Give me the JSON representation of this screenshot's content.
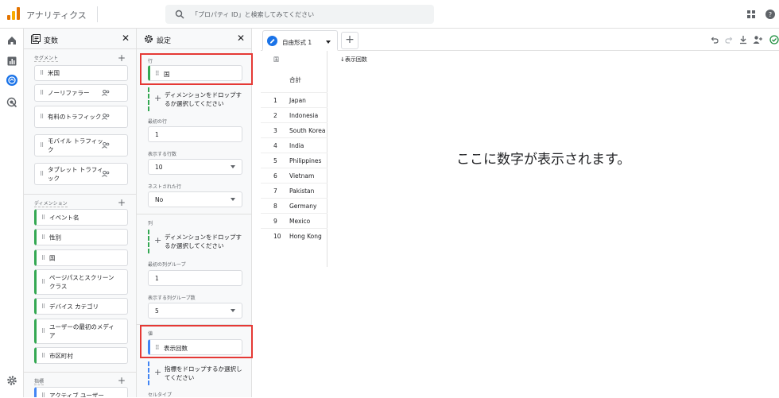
{
  "app": {
    "title": "アナリティクス"
  },
  "search": {
    "placeholder": "「プロパティ ID」と検索してみてください"
  },
  "variables_panel": {
    "title": "変数",
    "segments": {
      "label": "セグメント",
      "items": [
        "米国",
        "ノーリファラー",
        "有料のトラフィック",
        "モバイル トラフィック",
        "タブレット トラフィック"
      ]
    },
    "dimensions": {
      "label": "ディメンション",
      "items": [
        "イベント名",
        "性別",
        "国",
        "ページパスとスクリーン クラス",
        "デバイス カテゴリ",
        "ユーザーの最初のメディア",
        "市区町村"
      ]
    },
    "metrics": {
      "label": "指標",
      "items": [
        "アクティブ ユーザー"
      ]
    }
  },
  "settings_panel": {
    "title": "設定",
    "rows": {
      "label": "行",
      "chip": "国",
      "drop": "ディメンションをドロップするか選択してください"
    },
    "first_row": {
      "label": "最初の行",
      "value": "1"
    },
    "rows_shown": {
      "label": "表示する行数",
      "value": "10"
    },
    "nested_rows": {
      "label": "ネストされた行",
      "value": "No"
    },
    "columns": {
      "label": "列",
      "drop": "ディメンションをドロップするか選択してください"
    },
    "first_col_group": {
      "label": "最初の列グループ",
      "value": "1"
    },
    "col_groups_shown": {
      "label": "表示する列グループ数",
      "value": "5"
    },
    "values": {
      "label": "値",
      "chip": "表示回数",
      "drop": "指標をドロップするか選択してください"
    },
    "cell_type": {
      "label": "セルタイプ"
    }
  },
  "canvas": {
    "tab_label": "自由形式 1",
    "dim_header": "国",
    "metric_header": "↓表示回数",
    "totals_label": "合計",
    "rows": [
      {
        "n": "1",
        "country": "Japan"
      },
      {
        "n": "2",
        "country": "Indonesia"
      },
      {
        "n": "3",
        "country": "South Korea"
      },
      {
        "n": "4",
        "country": "India"
      },
      {
        "n": "5",
        "country": "Philippines"
      },
      {
        "n": "6",
        "country": "Vietnam"
      },
      {
        "n": "7",
        "country": "Pakistan"
      },
      {
        "n": "8",
        "country": "Germany"
      },
      {
        "n": "9",
        "country": "Mexico"
      },
      {
        "n": "10",
        "country": "Hong Kong"
      }
    ],
    "placeholder": "ここに数字が表示されます。"
  },
  "colors": {
    "accent": "#1a73e8",
    "dimension": "#34a853",
    "metric": "#4285f4",
    "highlight": "#e53935"
  }
}
